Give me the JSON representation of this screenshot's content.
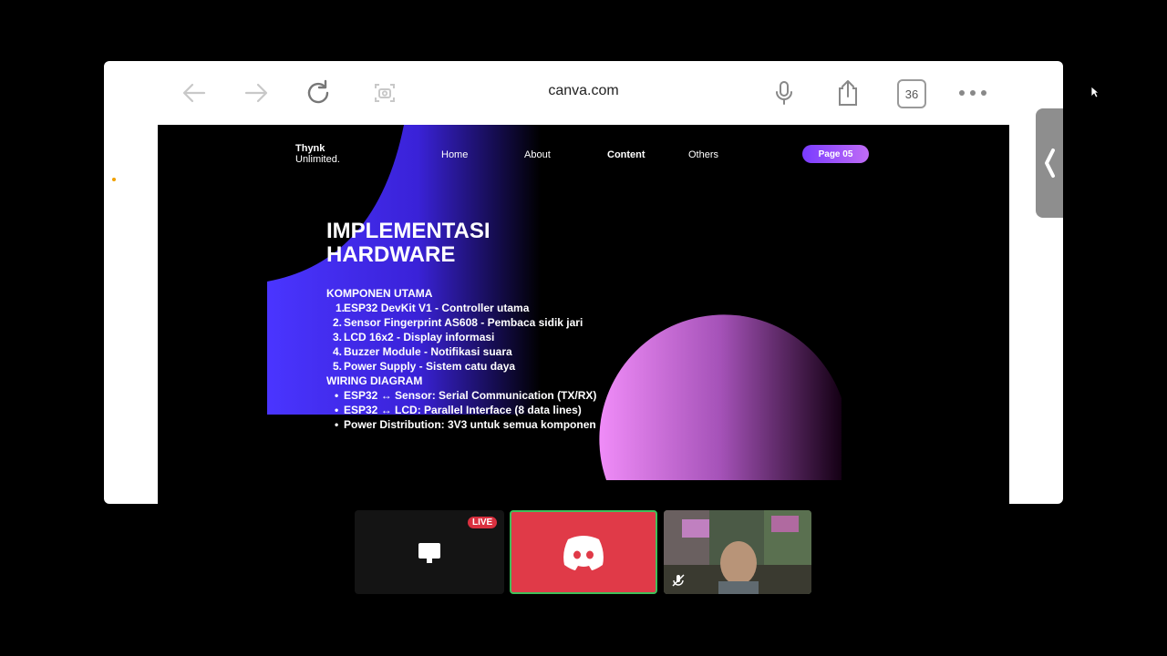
{
  "browser": {
    "url": "canva.com",
    "tab_count": "36",
    "icons": [
      "back-arrow-icon",
      "forward-arrow-icon",
      "reload-icon",
      "screenshot-icon",
      "microphone-icon",
      "share-icon",
      "tabs-icon",
      "more-icon"
    ]
  },
  "slide": {
    "brand_line1": "Thynk",
    "brand_line2": "Unlimited.",
    "nav": [
      "Home",
      "About",
      "Content",
      "Others"
    ],
    "active_nav": "Content",
    "page_label": "Page 05",
    "title": "IMPLEMENTASI\nHARDWARE",
    "section1": "KOMPONEN UTAMA",
    "components": [
      "ESP32 DevKit V1 - Controller utama",
      "Sensor Fingerprint AS608 - Pembaca sidik jari",
      "LCD 16x2 - Display informasi",
      "Buzzer Module - Notifikasi suara",
      "Power Supply - Sistem catu daya"
    ],
    "component_numbers": [
      "1.",
      "2.",
      "3.",
      "4.",
      "5."
    ],
    "section2": "WIRING DIAGRAM",
    "wiring": [
      "ESP32 ↔ Sensor: Serial Communication (TX/RX)",
      "ESP32 ↔ LCD: Parallel Interface (8 data lines)",
      "Power Distribution: 3V3 untuk semua komponen"
    ],
    "colors": {
      "accent_blue": "#4a35ff",
      "accent_pink": "#e88cf0",
      "pill": "#9a4cf8"
    }
  },
  "call": {
    "live_badge": "LIVE",
    "tiles": [
      "screen-share-tile",
      "discord-tile",
      "camera-tile"
    ],
    "discord_color": "#e03a48"
  }
}
